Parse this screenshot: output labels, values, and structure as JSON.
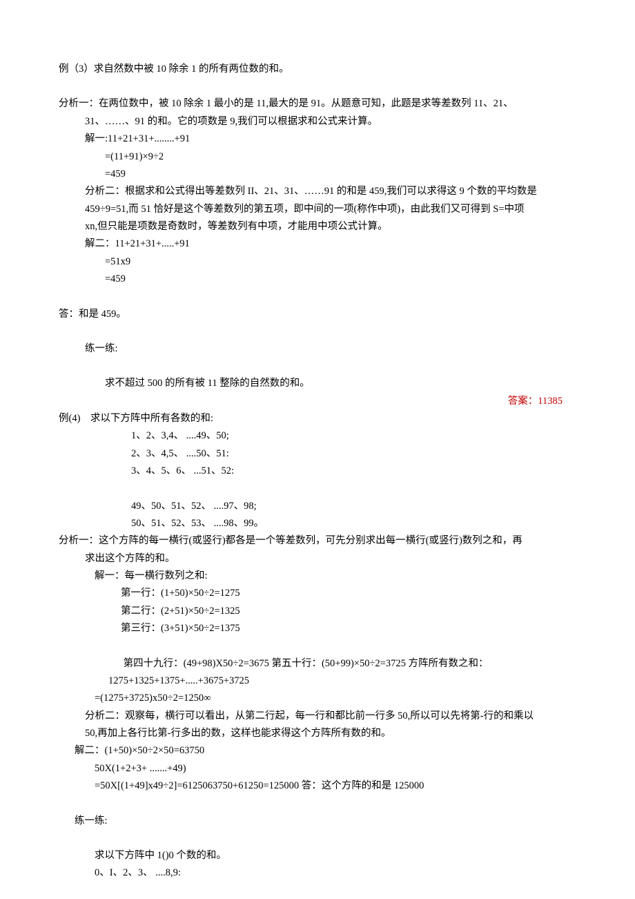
{
  "ex3": {
    "title": "例（3）求自然数中被 10 除余 1 的所有两位数的和。",
    "analysis1_l1": "分析一：在两位数中，被 10 除余 1 最小的是 11,最大的是 91。从题意可知，此题是求等差数列 11、21、",
    "analysis1_l2": "31、……、91 的和。它的项数是 9,我们可以根据求和公式来计算。",
    "sol1_l1": "解一:11+21+31+........+91",
    "sol1_l2": "=(11+91)×9÷2",
    "sol1_l3": "=459",
    "analysis2_l1": "分析二：根据求和公式得出等差数列 II、21、31、……91 的和是 459,我们可以求得这 9 个数的平均数是",
    "analysis2_l2": "459÷9=51,而 51 恰好是这个等差数列的第五项，即中间的一项(称作中项)，由此我们又可得到 S=中项",
    "analysis2_l3": "xn,但只能是项数是奇数时，等差数列有中项，才能用中项公式计算。",
    "sol2_l1": "解二：11+21+31+.....+91",
    "sol2_l2": "=51x9",
    "sol2_l3": "=459",
    "answer_line": "答：和是 459。",
    "practice_title": "练一练:",
    "practice_q": "求不超过 500 的所有被 11 整除的自然数的和。",
    "practice_a": "答案：11385"
  },
  "ex4": {
    "title": "例(4)    求以下方阵中所有各数的和:",
    "row1": "1、2、3,4、 ....49、50;",
    "row2": "2、3、4,5、 ....50、51:",
    "row3": "3、4、5、6、 ...51、52:",
    "row4": "49、50、51、52、 ....97、98;",
    "row5": "50、51、52、53、 ....98、99。",
    "analysis1_l1": "分析一：这个方阵的每一横行(或竖行)都各是一个等差数列，可先分别求出每一横行(或竖行)数列之和，再",
    "analysis1_l2": "求出这个方阵的和。",
    "sol1_l1": "解一：每一横行数列之和:",
    "sol1_r1": "第一行：(1+50)×50÷2=1275",
    "sol1_r2": "第二行：(2+51)×50÷2=1325",
    "sol1_r3": "第三行：(3+51)×50÷2=1375",
    "sol1_r49": " 第四十九行：(49+98)X50÷2=3675 第五十行：(50+99)×50÷2=3725 方阵所有数之和：",
    "sol1_sum1": "1275+1325+1375+.....+3675+3725",
    "sol1_sum2": "=(1275+3725)x50÷2=1250∞",
    "analysis2_l1": "分析二：观察每，横行可以看出，从第二行起，每一行和都比前一行多 50,所以可以先将第-行的和乘以",
    "analysis2_l2": "50,再加上各行比第-行多出的数，这样也能求得这个方阵所有数的和。",
    "sol2_l1": "解二：(1+50)×50÷2×50=63750",
    "sol2_l2": "50X(1+2+3+ .......+49)",
    "sol2_l3": "=50X[(1+49]x49÷2]=6125063750+61250=125000 答：这个方阵的和是 125000",
    "practice_title": "练一练:",
    "practice_q1": "求以下方阵中 1()0 个数的和。",
    "practice_q2": "0、I、2、3、 ....8,9:"
  }
}
